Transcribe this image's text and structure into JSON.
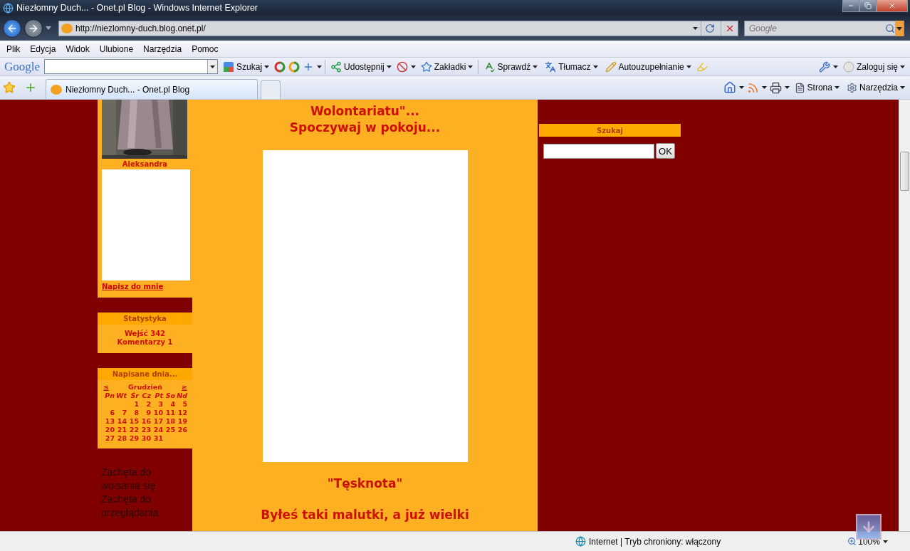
{
  "window": {
    "title": "Niezłomny Duch... - Onet.pl Blog - Windows Internet Explorer"
  },
  "address_bar": {
    "url": "http://niezlomny-duch.blog.onet.pl/"
  },
  "search_box": {
    "placeholder": "Google"
  },
  "menu": [
    "Plik",
    "Edycja",
    "Widok",
    "Ulubione",
    "Narzędzia",
    "Pomoc"
  ],
  "google_toolbar": {
    "logo": "Google",
    "items": [
      {
        "label": "Szukaj"
      },
      {
        "label": "Udostępnij"
      },
      {
        "label": "Zakładki"
      },
      {
        "label": "Sprawdź"
      },
      {
        "label": "Tłumacz"
      },
      {
        "label": "Autouzupełnianie"
      }
    ],
    "sign_in": "Zaloguj się"
  },
  "tabs": [
    {
      "label": "Niezłomny Duch... - Onet.pl Blog",
      "selected": true
    }
  ],
  "command_bar": [
    "Strona",
    "Narzędzia"
  ],
  "page": {
    "left": {
      "caption": "Aleksandra",
      "link": "Napisz do mnie",
      "stats": {
        "title": "Statystyka",
        "lines": [
          "Wejść 342",
          "Komentarzy 1"
        ]
      },
      "calendar": {
        "title": "Napisane dnia...",
        "prev": "≤",
        "month": "Grudzień",
        "next": "≥",
        "weekdays": [
          "Pn",
          "Wt",
          "Śr",
          "Cz",
          "Pt",
          "So",
          "Nd"
        ],
        "weeks": [
          [
            "1",
            "2",
            "3",
            "4",
            "5"
          ],
          [
            "6",
            "7",
            "8",
            "9",
            "10",
            "11",
            "12"
          ],
          [
            "13",
            "14",
            "15",
            "16",
            "17",
            "18",
            "19"
          ],
          [
            "20",
            "21",
            "22",
            "23",
            "24",
            "25",
            "26"
          ],
          [
            "27",
            "28",
            "29",
            "30",
            "31"
          ]
        ]
      },
      "invites": [
        "Zachęta do wpisania się",
        "Zachęta do przeglądania"
      ]
    },
    "post": {
      "heading": [
        "Wolontariatu\"...",
        "Spoczywaj w pokoju..."
      ],
      "poem_title": "\"Tęsknota\"",
      "poem_line": "Byłeś taki malutki, a już wielki"
    },
    "right": {
      "search_title": "Szukaj",
      "button": "OK"
    }
  },
  "status_bar": {
    "zone": "Internet | Tryb chroniony: włączony",
    "zoom": "100%"
  }
}
